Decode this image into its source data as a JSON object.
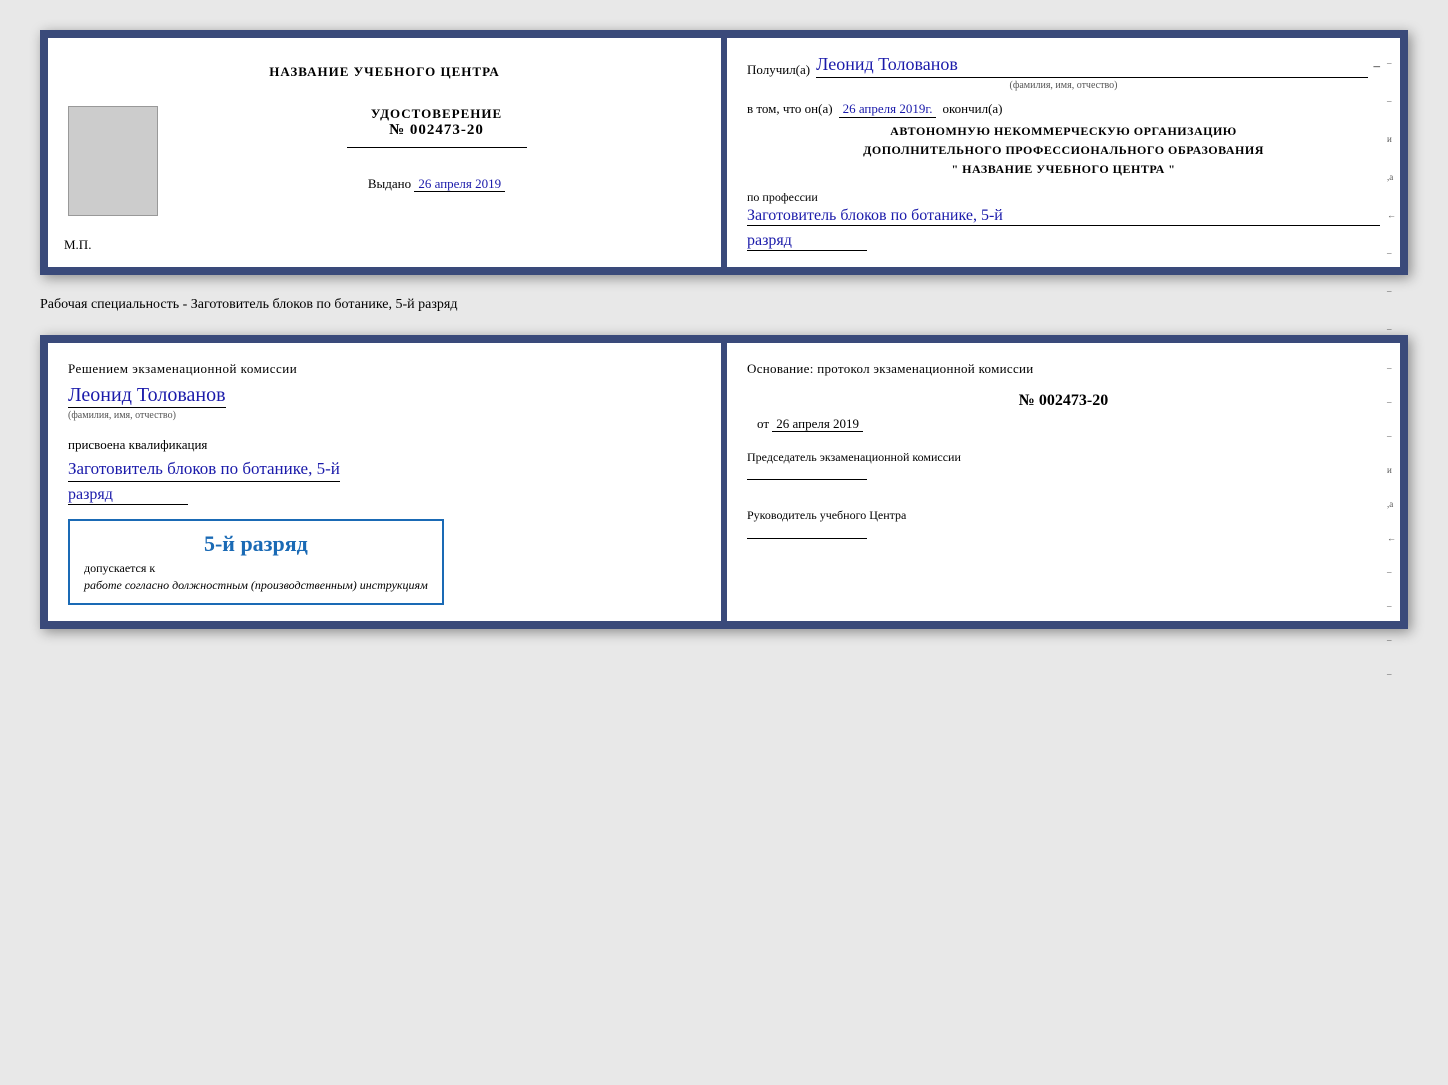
{
  "page": {
    "background_color": "#e8e8e8"
  },
  "top_book": {
    "left": {
      "school_title": "НАЗВАНИЕ УЧЕБНОГО ЦЕНТРА",
      "udostoverenie_label": "УДОСТОВЕРЕНИЕ",
      "cert_number": "№ 002473-20",
      "vydano_label": "Выдано",
      "vydano_date": "26 апреля 2019",
      "mp_label": "М.П."
    },
    "right": {
      "poluchil_label": "Получил(а)",
      "poluchil_name": "Леонид Толованов",
      "name_hint": "(фамилия, имя, отчество)",
      "vtom_text": "в том, что он(а)",
      "vtom_date": "26 апреля 2019г.",
      "okончил_label": "окончил(а)",
      "org_line1": "АВТОНОМНУЮ НЕКОММЕРЧЕСКУЮ ОРГАНИЗАЦИЮ",
      "org_line2": "ДОПОЛНИТЕЛЬНОГО ПРОФЕССИОНАЛЬНОГО ОБРАЗОВАНИЯ",
      "org_line3": "\"   НАЗВАНИЕ УЧЕБНОГО ЦЕНТРА   \"",
      "poprofessii_label": "по профессии",
      "profession": "Заготовитель блоков по ботанике, 5-й",
      "razryad": "разряд",
      "dash": "–"
    }
  },
  "specialty_label": "Рабочая специальность - Заготовитель блоков по ботанике, 5-й разряд",
  "bottom_book": {
    "left": {
      "resheniem_label": "Решением экзаменационной комиссии",
      "person_name": "Леонид Толованов",
      "name_hint": "(фамилия, имя, отчество)",
      "prisvoena_label": "присвоена квалификация",
      "qualification": "Заготовитель блоков по ботанике, 5-й",
      "razryad": "разряд",
      "stamp_text": "5-й разряд",
      "dopuskaetsya_label": "допускается к",
      "dopuskaetsya_italic": "работе согласно должностным (производственным) инструкциям"
    },
    "right": {
      "osnovanie_label": "Основание: протокол экзаменационной комиссии",
      "protocol_number": "№  002473-20",
      "ot_label": "от",
      "ot_date": "26 апреля 2019",
      "predsedatel_label": "Председатель экзаменационной комиссии",
      "rukovoditel_label": "Руководитель учебного Центра"
    }
  },
  "icons": {
    "dash": "–"
  }
}
